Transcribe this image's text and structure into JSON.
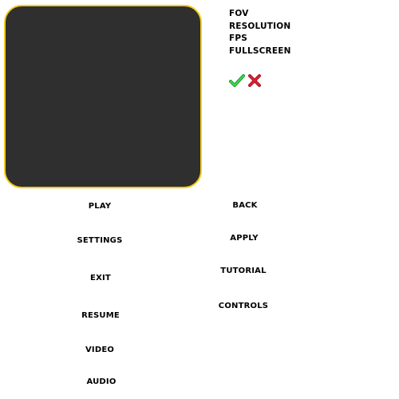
{
  "preview_panel": {
    "fill_color": "#2f2f2f",
    "border_color": "#f3cc1b"
  },
  "settings_options": [
    "FOV",
    "RESOLUTION",
    "FPS",
    "FULLSCREEN"
  ],
  "icons": {
    "confirm": "checkmark-icon",
    "cancel": "x-icon",
    "confirm_color": "#22c03a",
    "cancel_color": "#d81b2a"
  },
  "menu_left": {
    "play": "PLAY",
    "settings": "SETTINGS",
    "exit": "EXIT",
    "resume": "RESUME",
    "video": "VIDEO",
    "audio": "AUDIO"
  },
  "menu_right": {
    "back": "BACK",
    "apply": "APPLY",
    "tutorial": "TUTORIAL",
    "controls": "CONTROLS"
  }
}
